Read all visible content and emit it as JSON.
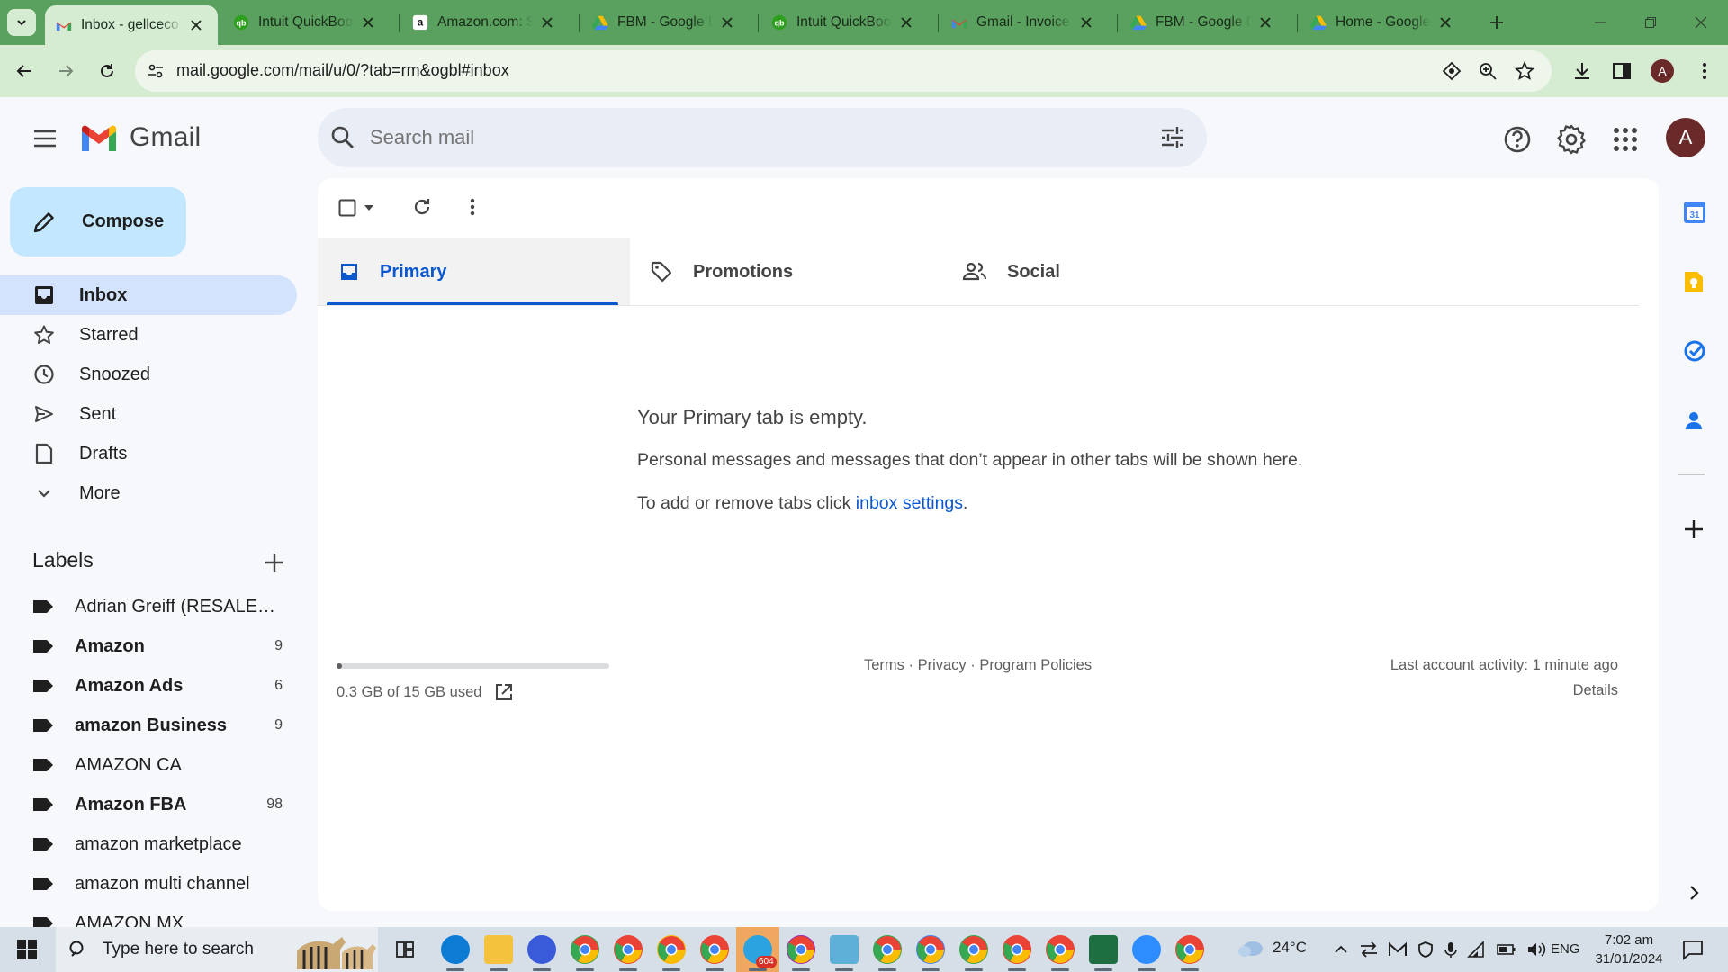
{
  "browser": {
    "tabs": [
      {
        "title": "Inbox - gellceco",
        "favicon": "gmail-icon",
        "active": true
      },
      {
        "title": "Intuit QuickBook",
        "favicon": "quickbooks-icon"
      },
      {
        "title": "Amazon.com: Su",
        "favicon": "amazon-icon"
      },
      {
        "title": "FBM - Google D",
        "favicon": "google-drive-icon"
      },
      {
        "title": "Intuit QuickBook",
        "favicon": "quickbooks-icon"
      },
      {
        "title": "Gmail - Invoice /",
        "favicon": "gmail-icon"
      },
      {
        "title": "FBM - Google D",
        "favicon": "google-drive-icon"
      },
      {
        "title": "Home - Google",
        "favicon": "google-drive-icon"
      }
    ],
    "url": "mail.google.com/mail/u/0/?tab=rm&ogbl#inbox",
    "profile_initial": "A"
  },
  "gmail": {
    "logo_text": "Gmail",
    "search_placeholder": "Search mail",
    "account_initial": "A",
    "compose_label": "Compose",
    "nav": [
      {
        "label": "Inbox",
        "icon": "inbox-icon",
        "selected": true
      },
      {
        "label": "Starred",
        "icon": "star-icon"
      },
      {
        "label": "Snoozed",
        "icon": "clock-icon"
      },
      {
        "label": "Sent",
        "icon": "send-icon"
      },
      {
        "label": "Drafts",
        "icon": "draft-icon"
      },
      {
        "label": "More",
        "icon": "chevron-down-icon"
      }
    ],
    "labels_heading": "Labels",
    "labels": [
      {
        "name": "Adrian Greiff (RESALE C...",
        "count": "",
        "bold": false
      },
      {
        "name": "Amazon",
        "count": "9",
        "bold": true
      },
      {
        "name": "Amazon Ads",
        "count": "6",
        "bold": true
      },
      {
        "name": "amazon Business",
        "count": "9",
        "bold": true
      },
      {
        "name": "AMAZON CA",
        "count": "",
        "bold": false
      },
      {
        "name": "Amazon FBA",
        "count": "98",
        "bold": true
      },
      {
        "name": "amazon marketplace",
        "count": "",
        "bold": false
      },
      {
        "name": "amazon multi channel",
        "count": "",
        "bold": false
      },
      {
        "name": "AMAZON MX",
        "count": "",
        "bold": false
      }
    ],
    "tabs": [
      {
        "label": "Primary",
        "icon": "inbox-tab-icon",
        "active": true
      },
      {
        "label": "Promotions",
        "icon": "tag-icon"
      },
      {
        "label": "Social",
        "icon": "people-icon"
      }
    ],
    "empty": {
      "title": "Your Primary tab is empty.",
      "line1": "Personal messages and messages that don’t appear in other tabs will be shown here.",
      "line2_prefix": "To add or remove tabs click ",
      "line2_link": "inbox settings",
      "line2_suffix": "."
    },
    "storage": {
      "text": "0.3 GB of 15 GB used",
      "fraction": 0.02
    },
    "footer_links": {
      "terms": "Terms",
      "sep1": " · ",
      "privacy": "Privacy",
      "sep2": " · ",
      "policies": "Program Policies"
    },
    "activity": {
      "text": "Last account activity: 1 minute ago",
      "details": "Details"
    }
  },
  "taskbar": {
    "search_placeholder": "Type here to search",
    "weather": "24°C",
    "language": "ENG",
    "time": "7:02 am",
    "date": "31/01/2024",
    "telegram_badge": "604"
  },
  "colors": {
    "tabstrip": "#5aa05e",
    "toolbar": "#d6ecd2",
    "accent": "#0b57d0",
    "selected_nav": "#d3e3fd",
    "compose": "#c2e7ff"
  }
}
